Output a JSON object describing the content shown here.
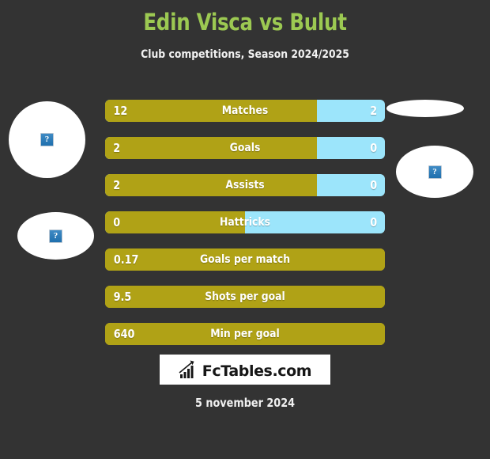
{
  "header": {
    "title": "Edin Visca vs Bulut",
    "subtitle": "Club competitions, Season 2024/2025",
    "title_color": "#9cc952",
    "subtitle_color": "#f2f2f2"
  },
  "colors": {
    "background": "#333333",
    "home_bar": "#b0a216",
    "away_bar": "#9ce5fb",
    "value_text": "#ffffff"
  },
  "placeholders": [
    {
      "name": "home-player-photo",
      "alt": "?"
    },
    {
      "name": "home-club-logo",
      "alt": "?"
    },
    {
      "name": "away-player-photo",
      "alt": ""
    },
    {
      "name": "away-club-logo",
      "alt": "?"
    }
  ],
  "chart_data": {
    "type": "bar",
    "title": "Edin Visca vs Bulut",
    "subtitle": "Club competitions, Season 2024/2025",
    "orientation": "horizontal-split",
    "series": [
      {
        "name": "Edin Visca",
        "color": "#b0a216"
      },
      {
        "name": "Bulut",
        "color": "#9ce5fb"
      }
    ],
    "categories": [
      "Matches",
      "Goals",
      "Assists",
      "Hattricks",
      "Goals per match",
      "Shots per goal",
      "Min per goal"
    ],
    "rows": [
      {
        "label": "Matches",
        "home": "12",
        "away": "2",
        "home_pct": 75.7,
        "split": true
      },
      {
        "label": "Goals",
        "home": "2",
        "away": "0",
        "home_pct": 75.7,
        "split": true
      },
      {
        "label": "Assists",
        "home": "2",
        "away": "0",
        "home_pct": 75.7,
        "split": true
      },
      {
        "label": "Hattricks",
        "home": "0",
        "away": "0",
        "home_pct": 50.0,
        "split": true
      },
      {
        "label": "Goals per match",
        "home": "0.17",
        "away": "",
        "home_pct": 100,
        "split": false
      },
      {
        "label": "Shots per goal",
        "home": "9.5",
        "away": "",
        "home_pct": 100,
        "split": false
      },
      {
        "label": "Min per goal",
        "home": "640",
        "away": "",
        "home_pct": 100,
        "split": false
      }
    ]
  },
  "footer": {
    "logo_text": "FcTables.com",
    "logo_icon": "bar-chart-growth-icon",
    "date": "5 november 2024"
  }
}
